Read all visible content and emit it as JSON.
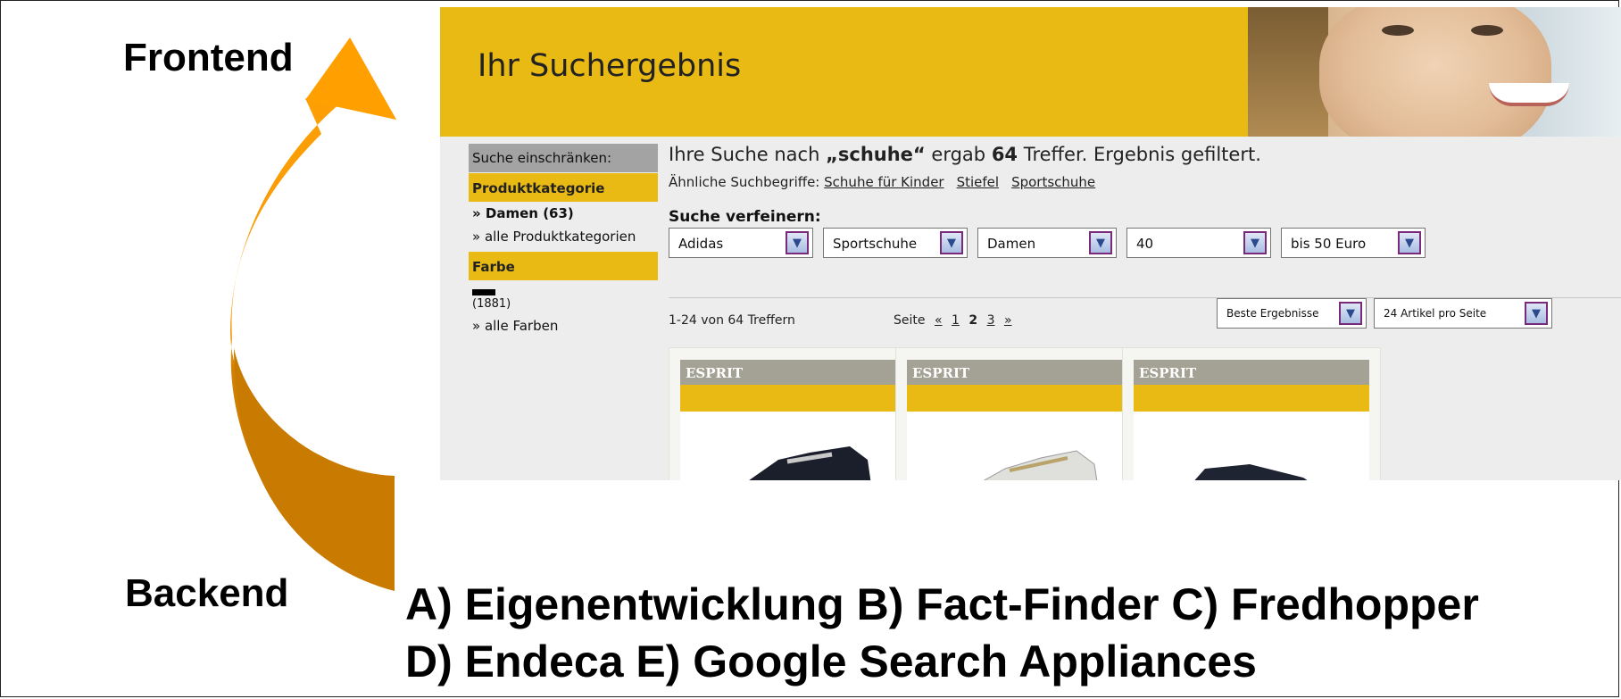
{
  "labels": {
    "frontend": "Frontend",
    "backend": "Backend"
  },
  "options": {
    "line1": "A) Eigenentwicklung B) Fact-Finder C) Fredhopper",
    "line2": "D) Endeca E) Google Search Appliances"
  },
  "screenshot": {
    "header_title": "Ihr Suchergebnis",
    "sidebar": {
      "heading": "Suche einschränken:",
      "category_title": "Produktkategorie",
      "category_selected": "» Damen (63)",
      "category_all": "» alle Produktkategorien",
      "color_title": "Farbe",
      "color_count": "(1881)",
      "color_all": "» alle Farben"
    },
    "result": {
      "prefix": "Ihre Suche nach ",
      "query": "„schuhe“",
      "middle": " ergab ",
      "count": "64",
      "suffix": " Treffer. Ergebnis gefiltert."
    },
    "similar": {
      "label": "Ähnliche Suchbegriffe:",
      "terms": [
        "Schuhe für Kinder",
        "Stiefel",
        "Sportschuhe"
      ]
    },
    "refine_label": "Suche verfeinern:",
    "filters": [
      "Adidas",
      "Sportschuhe",
      "Damen",
      "40",
      "bis 50 Euro"
    ],
    "pager": {
      "count": "1-24 von 64 Treffern",
      "page_label": "Seite",
      "prev": "«",
      "pages": [
        "1",
        "2",
        "3"
      ],
      "next": "»",
      "sort": "Beste Ergebnisse",
      "per_page": "24 Artikel pro Seite"
    },
    "products": [
      {
        "brand": "ESPRIT",
        "shoe_color": "#1b1f2c"
      },
      {
        "brand": "ESPRIT",
        "shoe_color": "#dfe0dc"
      },
      {
        "brand": "ESPRIT",
        "shoe_color": "#1f2433"
      }
    ]
  },
  "colors": {
    "arrow_light": "#ff9d00",
    "arrow_dark": "#c97a00",
    "accent_yellow": "#e9b914"
  }
}
